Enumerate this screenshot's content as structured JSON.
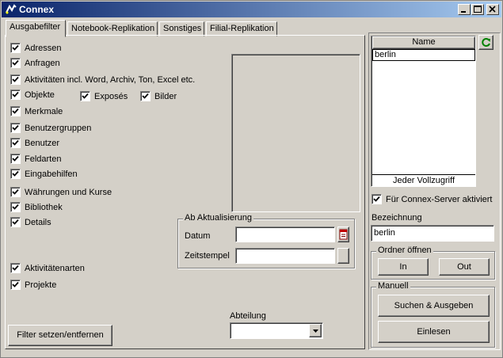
{
  "window": {
    "title": "Connex"
  },
  "tabs": [
    {
      "label": "Ausgabefilter",
      "active": true
    },
    {
      "label": "Notebook-Replikation",
      "active": false
    },
    {
      "label": "Sonstiges",
      "active": false
    },
    {
      "label": "Filial-Replikation",
      "active": false
    }
  ],
  "filters": [
    {
      "label": "Adressen",
      "checked": true
    },
    {
      "label": "Anfragen",
      "checked": true
    },
    {
      "label": "Aktivitäten incl. Word, Archiv, Ton, Excel etc.",
      "checked": true
    },
    {
      "label": "Objekte",
      "checked": true
    },
    {
      "label": "Merkmale",
      "checked": true
    },
    {
      "label": "Benutzergruppen",
      "checked": true
    },
    {
      "label": "Benutzer",
      "checked": true
    },
    {
      "label": "Feldarten",
      "checked": true
    },
    {
      "label": "Eingabehilfen",
      "checked": true
    },
    {
      "label": "Währungen und Kurse",
      "checked": true
    },
    {
      "label": "Bibliothek",
      "checked": true
    },
    {
      "label": "Details",
      "checked": true
    },
    {
      "label": "Aktivitätenarten",
      "checked": true
    },
    {
      "label": "Projekte",
      "checked": true
    }
  ],
  "object_options": [
    {
      "label": "Exposés",
      "checked": true
    },
    {
      "label": "Bilder",
      "checked": true
    }
  ],
  "update_group": {
    "legend": "Ab Aktualisierung",
    "date_label": "Datum",
    "date_value": "",
    "time_label": "Zeitstempel",
    "time_value": ""
  },
  "department": {
    "label": "Abteilung",
    "value": ""
  },
  "filter_button": "Filter setzen/entfernen",
  "name_list": {
    "header": "Name",
    "items": [
      "berlin"
    ],
    "footer": "Jeder Vollzugriff"
  },
  "server_checkbox": {
    "label": "Für Connex-Server aktiviert",
    "checked": true
  },
  "bezeichnung": {
    "label": "Bezeichnung",
    "value": "berlin"
  },
  "ordner_group": {
    "legend": "Ordner öffnen",
    "in_label": "In",
    "out_label": "Out"
  },
  "manuell_group": {
    "legend": "Manuell",
    "search_label": "Suchen & Ausgeben",
    "import_label": "Einlesen"
  },
  "colors": {
    "title_start": "#0a246a",
    "title_end": "#a6caf0",
    "face": "#d4d0c8",
    "selection": "#0a246a"
  }
}
